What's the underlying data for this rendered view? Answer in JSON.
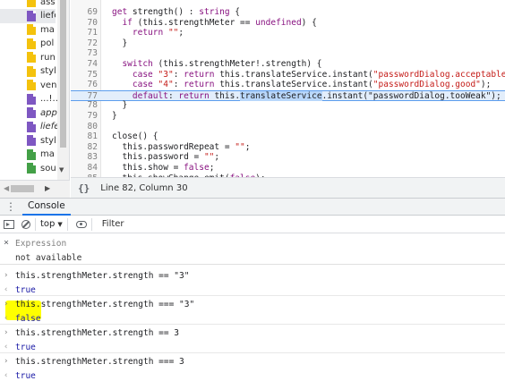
{
  "file_tree": {
    "items": [
      {
        "label": "ass",
        "color": "yellow",
        "italic": false,
        "selected": false
      },
      {
        "label": "liefe",
        "color": "purple",
        "italic": false,
        "selected": true
      },
      {
        "label": "ma",
        "color": "yellow",
        "italic": false,
        "selected": false
      },
      {
        "label": "pol",
        "color": "yellow",
        "italic": false,
        "selected": false
      },
      {
        "label": "run",
        "color": "yellow",
        "italic": false,
        "selected": false
      },
      {
        "label": "styl",
        "color": "yellow",
        "italic": false,
        "selected": false
      },
      {
        "label": "ven",
        "color": "yellow",
        "italic": false,
        "selected": false
      },
      {
        "label": "...!..",
        "color": "purple",
        "italic": false,
        "selected": false
      },
      {
        "label": "app",
        "color": "purple",
        "italic": true,
        "selected": false
      },
      {
        "label": "liefe",
        "color": "purple",
        "italic": true,
        "selected": false
      },
      {
        "label": "styl",
        "color": "purple",
        "italic": false,
        "selected": false
      },
      {
        "label": "ma",
        "color": "green",
        "italic": false,
        "selected": false
      },
      {
        "label": "sou",
        "color": "green",
        "italic": false,
        "selected": false
      }
    ]
  },
  "editor": {
    "lines": [
      {
        "n": "69",
        "code": "get strength() : string {"
      },
      {
        "n": "70",
        "code": "  if (this.strengthMeter == undefined) {"
      },
      {
        "n": "71",
        "code": "    return \"\";"
      },
      {
        "n": "72",
        "code": "  }"
      },
      {
        "n": "73",
        "code": ""
      },
      {
        "n": "74",
        "code": "  switch (this.strengthMeter!.strength) {"
      },
      {
        "n": "75",
        "code": "    case \"3\": return this.translateService.instant(\"passwordDialog.acceptable\");"
      },
      {
        "n": "76",
        "code": "    case \"4\": return this.translateService.instant(\"passwordDialog.good\");"
      },
      {
        "n": "77",
        "code_before": "    default: return this.",
        "code_selected": "translateService",
        "code_after": ".instant(\"passwordDialog.tooWeak\");",
        "highlight": true
      },
      {
        "n": "78",
        "code": "  }"
      },
      {
        "n": "79",
        "code": "}"
      },
      {
        "n": "80",
        "code": ""
      },
      {
        "n": "81",
        "code": "close() {"
      },
      {
        "n": "82",
        "code": "  this.passwordRepeat = \"\";"
      },
      {
        "n": "83",
        "code": "  this.password = \"\";"
      },
      {
        "n": "84",
        "code": "  this.show = false;"
      },
      {
        "n": "85",
        "code": "  this.showChange.emit(false);"
      }
    ]
  },
  "status_bar": {
    "braces": "{}",
    "cursor_position": "Line 82, Column 30"
  },
  "drawer": {
    "menu_icon": "⋮",
    "console_tab": "Console"
  },
  "console_toolbar": {
    "context": "top",
    "filter_placeholder": "Filter"
  },
  "console": {
    "expression": {
      "close": "×",
      "label": "Expression",
      "value": "not available"
    },
    "prompt_glyph": "›",
    "result_glyph": "‹",
    "entries": [
      {
        "command": "this.strengthMeter.strength == \"3\"",
        "result": "true"
      },
      {
        "command": "this.strengthMeter.strength === \"3\"",
        "result": "false"
      },
      {
        "command": "this.strengthMeter.strength == 3",
        "result": "true"
      },
      {
        "command": "this.strengthMeter.strength === 3",
        "result": "true"
      }
    ]
  },
  "colors": {
    "accent": "#1a73e8",
    "highlight_marker": "#ffff00",
    "line_highlight": "#e3eefb"
  }
}
